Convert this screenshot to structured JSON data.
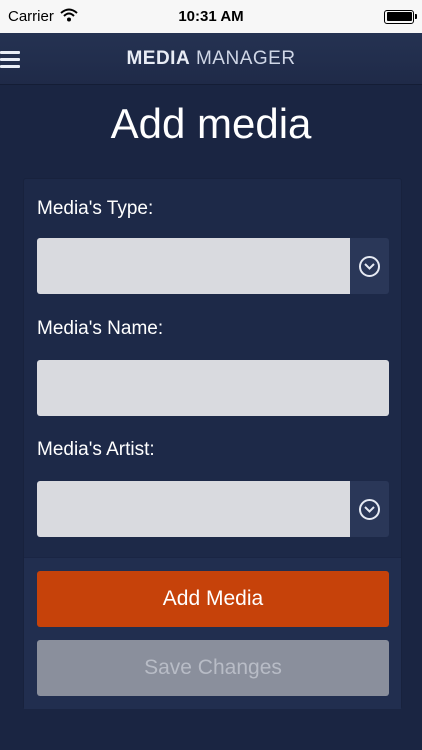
{
  "status_bar": {
    "carrier": "Carrier",
    "time": "10:31 AM",
    "battery_level": 1.0
  },
  "nav": {
    "title_bold": "MEDIA",
    "title_light": "MANAGER"
  },
  "page": {
    "title": "Add media"
  },
  "form": {
    "type_label": "Media's Type:",
    "type_value": "",
    "name_label": "Media's Name:",
    "name_value": "",
    "artist_label": "Media's Artist:",
    "artist_value": ""
  },
  "buttons": {
    "add_label": "Add Media",
    "save_label": "Save Changes"
  },
  "colors": {
    "background": "#1a2542",
    "accent": "#c6420a",
    "disabled": "#8a8f9c"
  }
}
